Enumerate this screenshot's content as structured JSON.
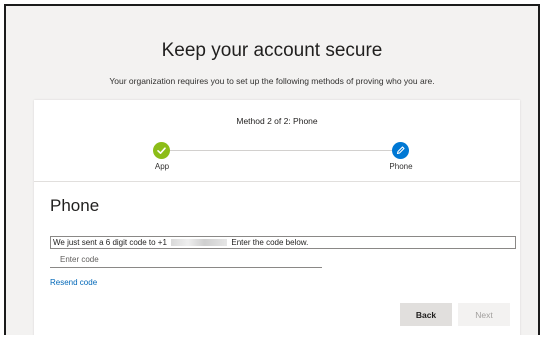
{
  "header": {
    "title": "Keep your account secure",
    "subtitle": "Your organization requires you to set up the following methods of proving who you are."
  },
  "progress": {
    "label": "Method 2 of 2: Phone",
    "steps": [
      {
        "label": "App",
        "status": "completed",
        "icon": "checkmark-icon",
        "color": "#8cbd18"
      },
      {
        "label": "Phone",
        "status": "current",
        "icon": "pencil-icon",
        "color": "#0078d4"
      }
    ]
  },
  "phone_section": {
    "title": "Phone",
    "message_before": "We just sent a 6 digit code to +1",
    "message_after": "Enter the code below.",
    "code_input": {
      "placeholder": "Enter code",
      "value": ""
    },
    "resend_label": "Resend code"
  },
  "buttons": {
    "back_label": "Back",
    "next_label": "Next"
  },
  "colors": {
    "accent": "#0078d4",
    "success": "#8cbd18",
    "link": "#0067b8"
  }
}
